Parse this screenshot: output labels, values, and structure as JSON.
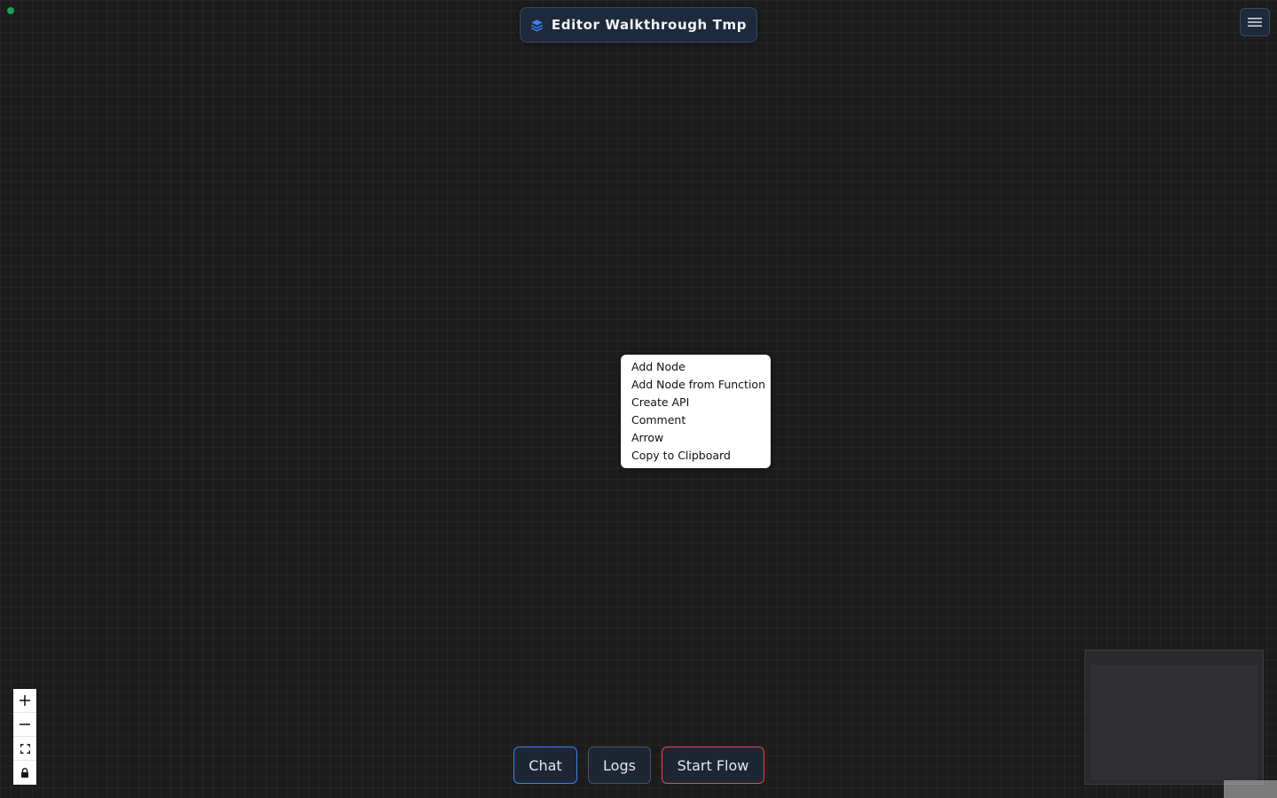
{
  "header": {
    "title": "Editor Walkthrough Tmp",
    "title_icon": "layers-icon"
  },
  "top_right": {
    "menu_icon": "hamburger-menu-icon"
  },
  "context_menu": {
    "items": [
      {
        "label": "Add Node"
      },
      {
        "label": "Add Node from Function"
      },
      {
        "label": "Create API"
      },
      {
        "label": "Comment"
      },
      {
        "label": "Arrow"
      },
      {
        "label": "Copy to Clipboard"
      }
    ]
  },
  "zoom_controls": {
    "icons": [
      "plus-icon",
      "minus-icon",
      "fit-view-icon",
      "lock-icon"
    ]
  },
  "bottom_bar": {
    "chat_label": "Chat",
    "logs_label": "Logs",
    "start_flow_label": "Start Flow"
  },
  "colors": {
    "canvas_background": "#1c1c1c",
    "status_dot": "#16a34a",
    "chat_border": "#3b82f6",
    "start_flow_border": "#ef4444",
    "title_icon": "#3b82f6"
  }
}
